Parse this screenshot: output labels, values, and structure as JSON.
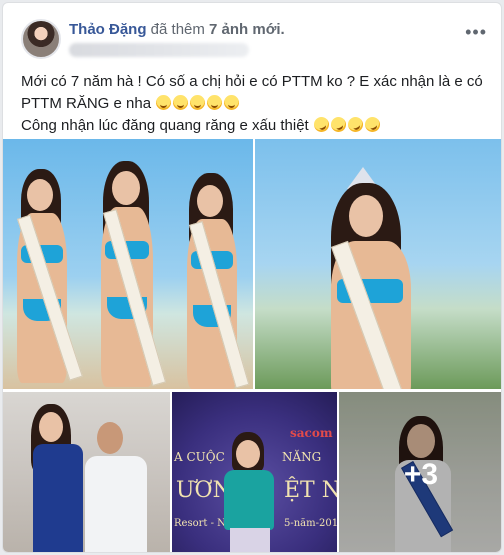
{
  "post": {
    "author": "Thảo Đặng",
    "action": "đã thêm",
    "photo_count": "7 ảnh mới.",
    "menu_icon": "more-horizontal-icon",
    "text_line1": "Mới có 7 năm hà  ! Có số a chị hỏi e có PTTM ko ? E xác nhận là e có PTTM RĂNG e nha",
    "text_line2": "Công nhận lúc đăng quang răng e xấu thiệt",
    "emoji_grin": "grinning-face-emoji",
    "emoji_rofl": "rolling-on-floor-laughing-emoji"
  },
  "photos": {
    "banner_line1": "A CUỘC",
    "banner_line2": "NĂNG",
    "banner_line3": "ƯƠN",
    "banner_line4": "ỆT NA",
    "banner_line5": "Resort - Ngày",
    "banner_line6": "5-năm-201",
    "banner_logo": "sacom",
    "more_count": "+3"
  },
  "colors": {
    "author": "#385898",
    "muted": "#606770",
    "bikini": "#1ea3d8"
  }
}
